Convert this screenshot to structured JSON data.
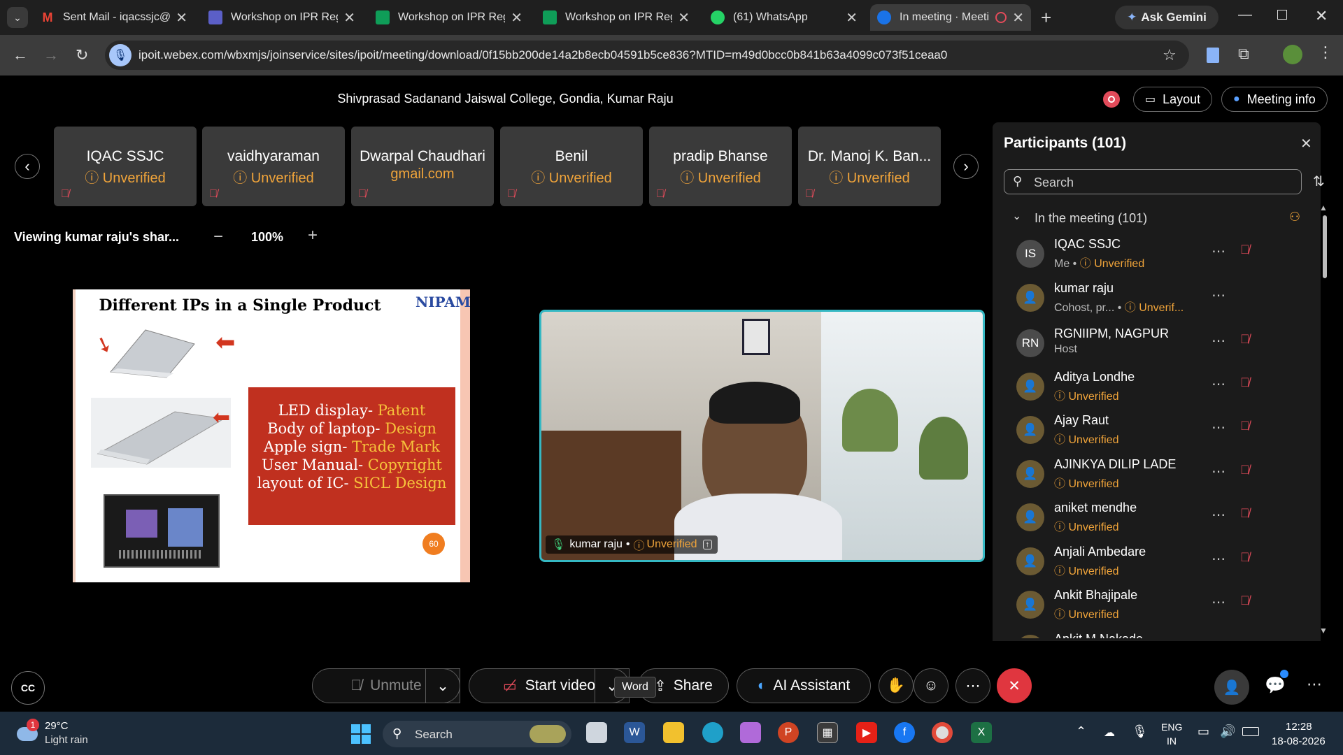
{
  "tabs": [
    {
      "title": "Sent Mail - iqacssjc@g",
      "color": "#ea4335"
    },
    {
      "title": "Workshop on IPR Regi",
      "color": "#5b5fc7"
    },
    {
      "title": "Workshop on IPR Regi",
      "color": "#0f9d58"
    },
    {
      "title": "Workshop on IPR Regi",
      "color": "#0f9d58"
    },
    {
      "title": "(61) WhatsApp",
      "color": "#25d366"
    },
    {
      "title": "In meeting · Meeti",
      "color": "#1a73e8"
    }
  ],
  "ask_gemini": "Ask Gemini",
  "url": "ipoit.webex.com/wbxmjs/joinservice/sites/ipoit/meeting/download/0f15bb200de14a2b8ecb04591b5ce836?MTID=m49d0bcc0b841b63a4099c073f51ceaa0",
  "meeting": {
    "title": "Shivprasad Sadanand Jaiswal College, Gondia, Kumar Raju",
    "layout_label": "Layout",
    "meeting_info_label": "Meeting info",
    "viewing_label": "Viewing kumar raju's shar...",
    "zoom": "100%"
  },
  "cards": [
    {
      "name": "IQAC SSJC",
      "sub": "Unverified"
    },
    {
      "name": "vaidhyaraman",
      "sub": "Unverified"
    },
    {
      "name": "Dwarpal Chaudhari",
      "sub": "gmail.com"
    },
    {
      "name": "Benil",
      "sub": "Unverified"
    },
    {
      "name": "pradip Bhanse",
      "sub": "Unverified"
    },
    {
      "name": "Dr. Manoj K. Ban...",
      "sub": "Unverified"
    }
  ],
  "slide": {
    "title": "Different IPs in a Single Product",
    "logo": "NIPAM",
    "page": "60",
    "lines": [
      {
        "k": "LED display- ",
        "v": "Patent"
      },
      {
        "k": "Body of laptop- ",
        "v": "Design"
      },
      {
        "k": "Apple sign- ",
        "v": "Trade Mark"
      },
      {
        "k": "User Manual- ",
        "v": "Copyright"
      },
      {
        "k": "layout of IC- ",
        "v": "SICL Design"
      }
    ]
  },
  "video": {
    "name": "kumar raju",
    "status": "Unverified"
  },
  "participants": {
    "header": "Participants (101)",
    "search_placeholder": "Search",
    "section": "In the meeting (101)",
    "list": [
      {
        "initials": "IS",
        "name": "IQAC SSJC",
        "role": "Me",
        "status": "Unverified"
      },
      {
        "initials": "",
        "name": "kumar raju",
        "role": "Cohost, pr...",
        "status": "Unverif..."
      },
      {
        "initials": "RN",
        "name": "RGNIIPM, NAGPUR",
        "role": "Host",
        "status": ""
      },
      {
        "initials": "",
        "name": "Aditya Londhe",
        "role": "",
        "status": "Unverified"
      },
      {
        "initials": "",
        "name": "Ajay Raut",
        "role": "",
        "status": "Unverified"
      },
      {
        "initials": "",
        "name": "AJINKYA DILIP LADE",
        "role": "",
        "status": "Unverified"
      },
      {
        "initials": "",
        "name": "aniket mendhe",
        "role": "",
        "status": "Unverified"
      },
      {
        "initials": "",
        "name": "Anjali Ambedare",
        "role": "",
        "status": "Unverified"
      },
      {
        "initials": "",
        "name": "Ankit Bhajipale",
        "role": "",
        "status": "Unverified"
      },
      {
        "initials": "",
        "name": "Ankit M Nakade",
        "role": "",
        "status": ""
      }
    ]
  },
  "controls": {
    "unmute": "Unmute",
    "start_video": "Start video",
    "share": "Share",
    "ai_assistant": "AI Assistant",
    "tooltip": "Word"
  },
  "taskbar": {
    "weather_temp": "29°C",
    "weather_desc": "Light rain",
    "weather_badge": "1",
    "search": "Search",
    "lang1": "ENG",
    "lang2": "IN",
    "time": "12:28",
    "date": "18-08-2026"
  }
}
